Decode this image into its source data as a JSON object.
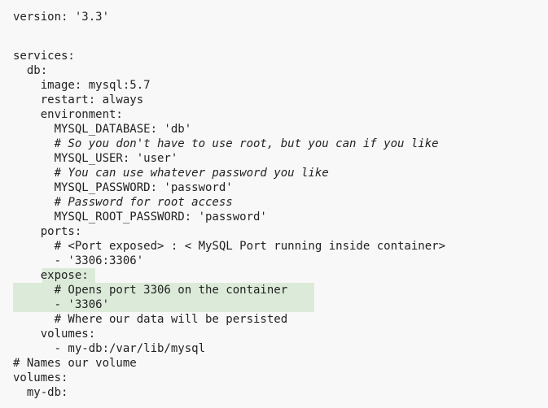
{
  "document": {
    "language": "YAML",
    "highlight_color": "#dcebd9",
    "lines": [
      "version: '3.3'",
      "",
      "",
      "services:",
      "  db:",
      "    image: mysql:5.7",
      "    restart: always",
      "    environment:",
      "      MYSQL_DATABASE: 'db'",
      "      # So you don't have to use root, but you can if you like",
      "      MYSQL_USER: 'user'",
      "      # You can use whatever password you like",
      "      MYSQL_PASSWORD: 'password'",
      "      # Password for root access",
      "      MYSQL_ROOT_PASSWORD: 'password'",
      "    ports:",
      "      # <Port exposed> : < MySQL Port running inside container>",
      "      - '3306:3306'",
      "    expose:",
      "      # Opens port 3306 on the container",
      "      - '3306'",
      "      # Where our data will be persisted",
      "    volumes:",
      "      - my-db:/var/lib/mysql",
      "# Names our volume",
      "volumes:",
      "  my-db:"
    ]
  }
}
